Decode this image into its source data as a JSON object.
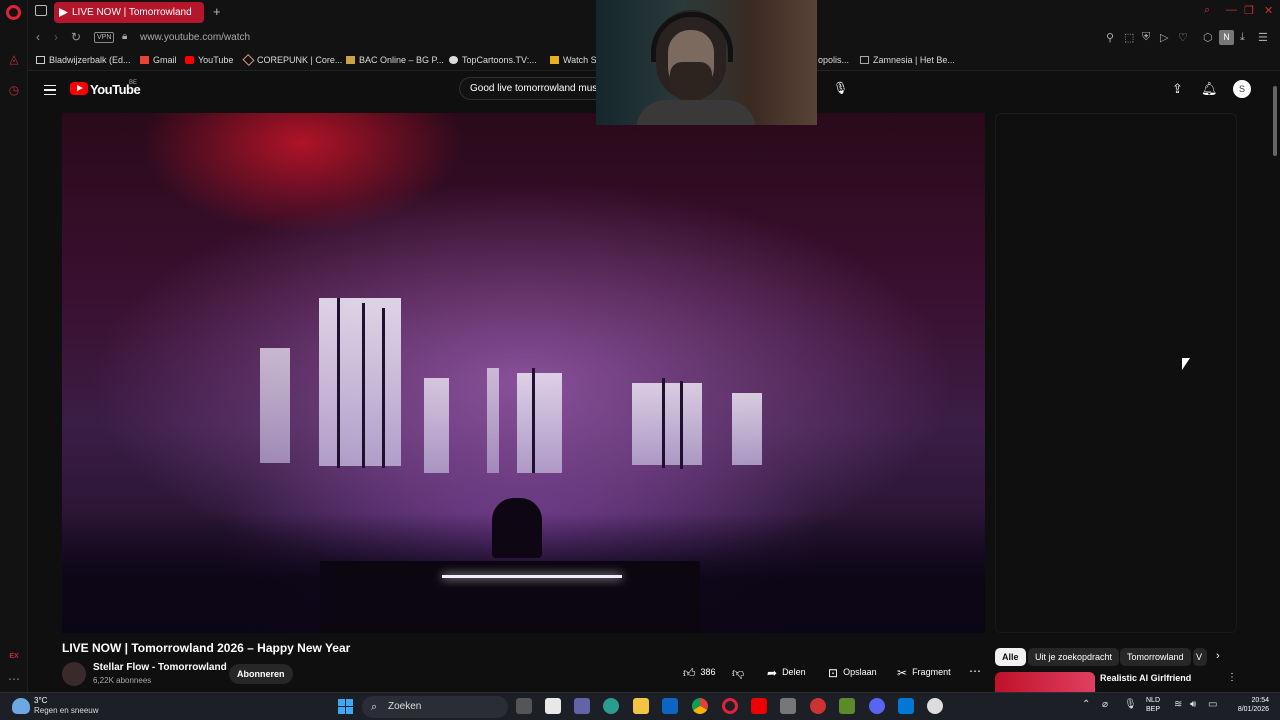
{
  "browser": {
    "tab_title": "LIVE NOW | Tomorrowland",
    "new_tab": "+",
    "vpn_label": "VPN",
    "url": "www.youtube.com/watch",
    "profile_initial": "N",
    "bookmarks": [
      {
        "label": "Bladwijzerbalk (Ed..."
      },
      {
        "label": "Gmail"
      },
      {
        "label": "YouTube"
      },
      {
        "label": "COREPUNK | Core..."
      },
      {
        "label": "BAC Online – BG P..."
      },
      {
        "label": "TopCartoons.TV:..."
      },
      {
        "label": "Watch S"
      },
      {
        "label": "opolis..."
      },
      {
        "label": "Zamnesia | Het Be..."
      }
    ],
    "sidebar_extra_label": "EX"
  },
  "youtube": {
    "logo_text": "YouTube",
    "country_code": "BE",
    "search_value": "Good live tomorrowland music",
    "avatar_initial": "S",
    "video": {
      "title": "LIVE NOW | Tomorrowland 2026 – Happy New Year",
      "channel_name": "Stellar Flow - Tomorrowland",
      "subscribers": "6,22K abonnees",
      "subscribe_label": "Abonneren",
      "likes": "386",
      "share_label": "Delen",
      "save_label": "Opslaan",
      "clip_label": "Fragment"
    },
    "chips": [
      "Alle",
      "Uit je zoekopdracht",
      "Tomorrowland",
      "V"
    ],
    "recommendation": {
      "title": "Realistic AI Girlfriend"
    }
  },
  "taskbar": {
    "temperature": "3°C",
    "weather": "Regen en sneeuw",
    "search_label": "Zoeken",
    "lang_top": "NLD",
    "lang_bottom": "BEP",
    "time": "20:54",
    "date": "8/01/2026"
  },
  "colors": {
    "opera_red": "#e0223a",
    "tab_active": "#b4162c",
    "youtube_red": "#ff0000",
    "background": "#0f0f0f"
  }
}
